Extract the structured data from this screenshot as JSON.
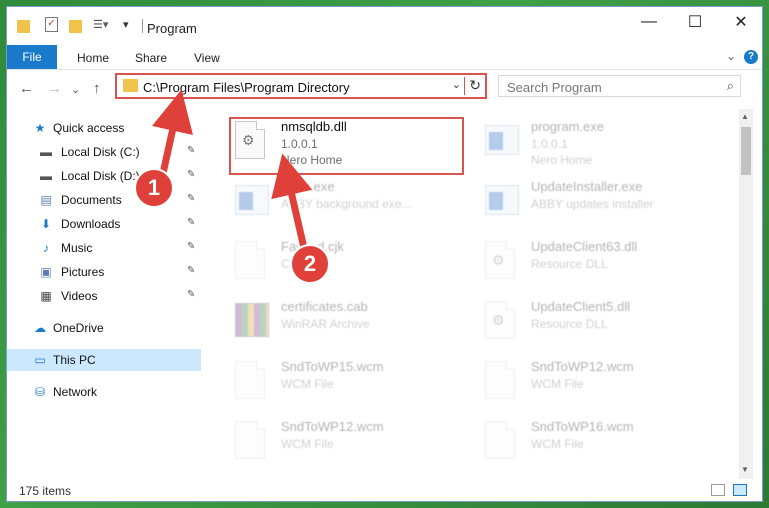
{
  "window": {
    "title": "Program",
    "minimize_glyph": "—",
    "maximize_glyph": "☐",
    "close_glyph": "✕"
  },
  "ribbon": {
    "tabs": [
      "File",
      "Home",
      "Share",
      "View"
    ],
    "help_glyph": "?",
    "expand_glyph": "⌄"
  },
  "address_bar": {
    "path": "C:\\Program Files\\Program Directory",
    "dropdown_glyph": "⌄",
    "refresh_glyph": "↻"
  },
  "search": {
    "placeholder": "Search Program",
    "icon": "search-icon"
  },
  "nav": {
    "back": "←",
    "forward": "→",
    "up": "↑",
    "recent": "⌄"
  },
  "sidebar": {
    "items": [
      {
        "label": "Quick access",
        "icon": "star-icon",
        "glyph": "★",
        "color": "#1979ca",
        "pinned": false
      },
      {
        "label": "Local Disk (C:)",
        "icon": "drive-icon",
        "glyph": "▬",
        "color": "#555555",
        "pinned": true
      },
      {
        "label": "Local Disk (D:)",
        "icon": "drive-icon",
        "glyph": "▬",
        "color": "#555555",
        "pinned": true
      },
      {
        "label": "Documents",
        "icon": "documents-icon",
        "glyph": "▤",
        "color": "#5a7fb0",
        "pinned": true
      },
      {
        "label": "Downloads",
        "icon": "download-icon",
        "glyph": "⬇",
        "color": "#1979ca",
        "pinned": true
      },
      {
        "label": "Music",
        "icon": "music-icon",
        "glyph": "♪",
        "color": "#1979ca",
        "pinned": true
      },
      {
        "label": "Pictures",
        "icon": "pictures-icon",
        "glyph": "▣",
        "color": "#5a7fb0",
        "pinned": true
      },
      {
        "label": "Videos",
        "icon": "videos-icon",
        "glyph": "▦",
        "color": "#444444",
        "pinned": true
      },
      {
        "label": "OneDrive",
        "icon": "cloud-icon",
        "glyph": "☁",
        "color": "#1979ca",
        "pinned": false
      },
      {
        "label": "This PC",
        "icon": "computer-icon",
        "glyph": "▭",
        "color": "#1979ca",
        "pinned": false
      },
      {
        "label": "Network",
        "icon": "network-icon",
        "glyph": "⛁",
        "color": "#1979ca",
        "pinned": false
      }
    ],
    "pin_glyph": "📌"
  },
  "files": [
    {
      "name": "nmsqldb.dll",
      "line2": "1.0.0.1",
      "line3": "Nero Home",
      "kind": "dll",
      "highlighted": true
    },
    {
      "name": "program.exe",
      "line2": "1.0.0.1",
      "line3": "Nero Home",
      "kind": "exe",
      "highlighted": false
    },
    {
      "name": "Exec.exe",
      "line2": "ABBY background exe...",
      "line3": "",
      "kind": "exe",
      "highlighted": false
    },
    {
      "name": "UpdateInstaller.exe",
      "line2": "ABBY updates installer",
      "line3": "",
      "kind": "exe",
      "highlighted": false
    },
    {
      "name": "Fast...d.cjk",
      "line2": "CJK",
      "line3": "",
      "kind": "doc",
      "highlighted": false
    },
    {
      "name": "UpdateClient63.dll",
      "line2": "Resource DLL",
      "line3": "",
      "kind": "dll",
      "highlighted": false
    },
    {
      "name": "certificates.cab",
      "line2": "WinRAR Archive",
      "line3": "",
      "kind": "rar",
      "highlighted": false
    },
    {
      "name": "UpdateClient5.dll",
      "line2": "Resource DLL",
      "line3": "",
      "kind": "dll",
      "highlighted": false
    },
    {
      "name": "SndToWP15.wcm",
      "line2": "WCM File",
      "line3": "",
      "kind": "doc",
      "highlighted": false
    },
    {
      "name": "SndToWP12.wcm",
      "line2": "WCM File",
      "line3": "",
      "kind": "doc",
      "highlighted": false
    },
    {
      "name": "SndToWP12.wcm",
      "line2": "WCM File",
      "line3": "",
      "kind": "doc",
      "highlighted": false
    },
    {
      "name": "SndToWP16.wcm",
      "line2": "WCM File",
      "line3": "",
      "kind": "doc",
      "highlighted": false
    }
  ],
  "status": {
    "items_count": "175 items"
  },
  "annotations": [
    {
      "number": "1",
      "color": "#e0403a"
    },
    {
      "number": "2",
      "color": "#e0403a"
    }
  ]
}
